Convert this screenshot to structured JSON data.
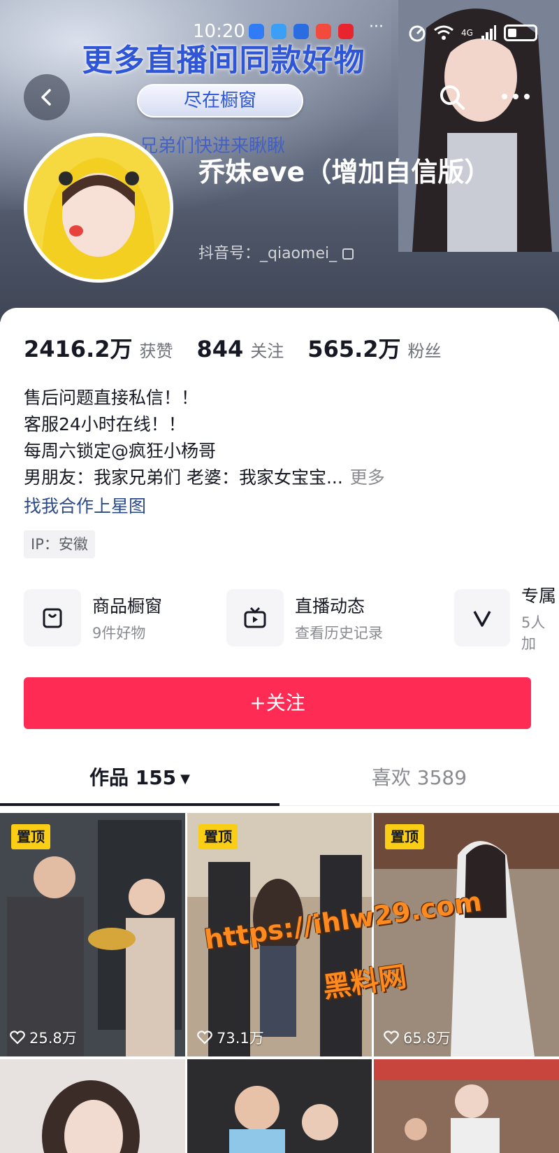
{
  "status_bar": {
    "time": "10:20",
    "overflow": "···",
    "signal_label": "4G"
  },
  "promo": {
    "title": "更多直播间同款好物",
    "pill": "尽在橱窗",
    "subtitle": "兄弟们快进来瞅瞅"
  },
  "profile": {
    "name": "乔妹eve（增加自信版）",
    "douyin_id": "抖音号：_qiaomei_"
  },
  "stats": [
    {
      "value": "2416.2万",
      "label": "获赞"
    },
    {
      "value": "844",
      "label": "关注"
    },
    {
      "value": "565.2万",
      "label": "粉丝"
    }
  ],
  "bio": {
    "line1": "售后问题直接私信！！",
    "line2": "客服24小时在线！！",
    "line3": "每周六锁定@疯狂小杨哥",
    "line4": "男朋友：我家兄弟们  老婆：我家女宝宝...",
    "more": "更多",
    "starlink": "找我合作上星图",
    "ip": "IP：安徽"
  },
  "services": [
    {
      "title": "商品橱窗",
      "sub": "9件好物",
      "icon": "shopping-bag-icon"
    },
    {
      "title": "直播动态",
      "sub": "查看历史记录",
      "icon": "tv-icon"
    },
    {
      "title": "专属",
      "sub": "5人加",
      "icon": "v-icon"
    }
  ],
  "follow_button": "+关注",
  "tabs": [
    {
      "label": "作品 155"
    },
    {
      "label": "喜欢 3589"
    }
  ],
  "videos": [
    {
      "pinned": "置顶",
      "likes": "25.8万"
    },
    {
      "pinned": "置顶",
      "likes": "73.1万"
    },
    {
      "pinned": "置顶",
      "likes": "65.8万"
    }
  ],
  "watermark": {
    "line1": "https://ihlw29.com",
    "line2": "黑料网"
  },
  "colors": {
    "accent": "#fe2c55",
    "pin": "#face15",
    "promo_blue": "#2f56d6",
    "link": "#2b4a8a"
  }
}
